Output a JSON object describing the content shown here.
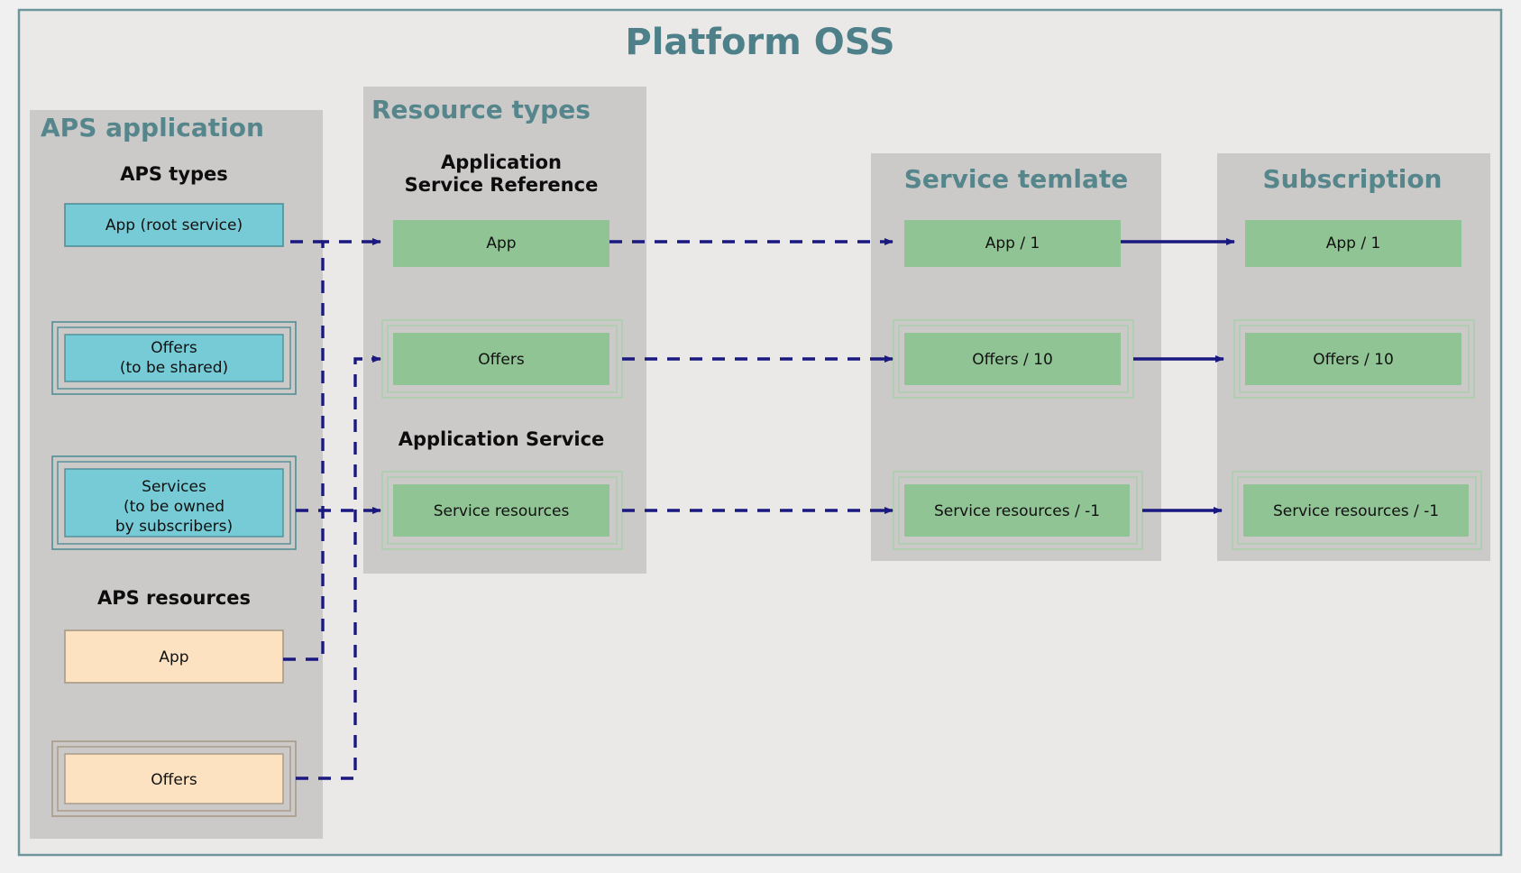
{
  "page": {
    "title": "Platform OSS",
    "frame_border_color": "#6e959a",
    "frame_fill": "#ebe8e8",
    "canvas_bg": "#f0f0f0"
  },
  "colors": {
    "panel_fill": "#ccc9c9",
    "panel_title": "#55868c",
    "main_title": "#4d8088",
    "cyan_fill": "#76cbd6",
    "cyan_border": "#4f8e97",
    "green_fill": "#90c494",
    "green_border": "#a9cfab",
    "peach_fill": "#fce2c0",
    "peach_border": "#a79a87",
    "arrow": "#191980",
    "text": "#111111"
  },
  "panels": [
    {
      "id": "aps-application",
      "title": "APS application",
      "title_size": 28
    },
    {
      "id": "resource-types",
      "title": "Resource types",
      "title_size": 28
    },
    {
      "id": "service-template",
      "title": "Service temlate",
      "title_size": 28
    },
    {
      "id": "subscription",
      "title": "Subscription",
      "title_size": 28
    }
  ],
  "groups": {
    "aps_types": "APS types",
    "aps_resources": "APS resources",
    "application_service_reference_line1": "Application",
    "application_service_reference_line2": "Service Reference",
    "application_service": "Application Service"
  },
  "boxes": {
    "aps_types": [
      {
        "id": "app-root-service",
        "lines": [
          "App (root service)"
        ],
        "nested": 1
      },
      {
        "id": "offers-shared",
        "lines": [
          "Offers",
          "(to be shared)"
        ],
        "nested": 3
      },
      {
        "id": "services-owned",
        "lines": [
          "Services",
          "(to be owned",
          "by subscribers)"
        ],
        "nested": 3
      }
    ],
    "aps_resources": [
      {
        "id": "resource-app",
        "lines": [
          "App"
        ],
        "nested": 1
      },
      {
        "id": "resource-offers",
        "lines": [
          "Offers"
        ],
        "nested": 3
      }
    ],
    "resource_types": [
      {
        "id": "rt-app",
        "lines": [
          "App"
        ],
        "nested": 1
      },
      {
        "id": "rt-offers",
        "lines": [
          "Offers"
        ],
        "nested": 3
      },
      {
        "id": "rt-service-resources",
        "lines": [
          "Service resources"
        ],
        "nested": 3
      }
    ],
    "service_template": [
      {
        "id": "st-app-1",
        "lines": [
          "App / 1"
        ],
        "nested": 1
      },
      {
        "id": "st-offers-10",
        "lines": [
          "Offers / 10"
        ],
        "nested": 3
      },
      {
        "id": "st-service-resources--1",
        "lines": [
          "Service resources / -1"
        ],
        "nested": 3
      }
    ],
    "subscription": [
      {
        "id": "sub-app-1",
        "lines": [
          "App / 1"
        ],
        "nested": 1
      },
      {
        "id": "sub-offers-10",
        "lines": [
          "Offers / 10"
        ],
        "nested": 3
      },
      {
        "id": "sub-service-resources--1",
        "lines": [
          "Service resources / -1"
        ],
        "nested": 3
      }
    ]
  },
  "connectors": [
    {
      "id": "app-type-to-rt-app",
      "style": "dashed"
    },
    {
      "id": "offers-resource-to-rt-offers",
      "style": "dashed"
    },
    {
      "id": "services-type-to-rt-service-resources",
      "style": "dashed"
    },
    {
      "id": "app-resource-to-riser",
      "style": "dashed"
    },
    {
      "id": "rt-app-to-st-app",
      "style": "dashed"
    },
    {
      "id": "rt-offers-to-st-offers",
      "style": "dashed"
    },
    {
      "id": "rt-sr-to-st-sr",
      "style": "dashed"
    },
    {
      "id": "st-app-to-sub-app",
      "style": "solid"
    },
    {
      "id": "st-offers-to-sub-offers",
      "style": "solid"
    },
    {
      "id": "st-sr-to-sub-sr",
      "style": "solid"
    }
  ]
}
